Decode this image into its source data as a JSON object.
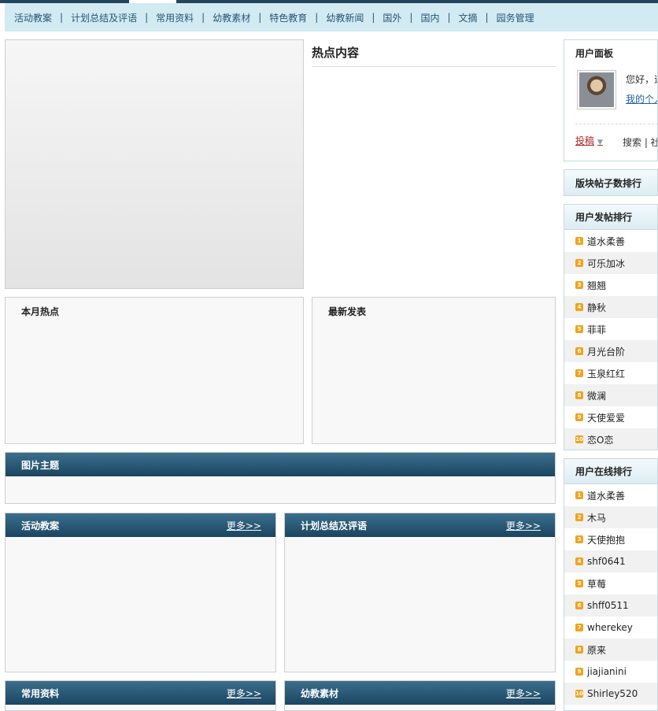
{
  "nav": {
    "items": [
      "活动教案",
      "计划总结及评语",
      "常用资料",
      "幼教素材",
      "特色教育",
      "幼教新闻",
      "国外",
      "国内",
      "文摘",
      "园务管理"
    ],
    "separator": "|"
  },
  "hot": {
    "title": "热点内容"
  },
  "month_hot": {
    "title": "本月热点"
  },
  "latest": {
    "title": "最新发表"
  },
  "photo_topic": {
    "title": "图片主题"
  },
  "sections": [
    {
      "title": "活动教案",
      "more": "更多>>"
    },
    {
      "title": "计划总结及评语",
      "more": "更多>>"
    },
    {
      "title": "常用资料",
      "more": "更多>>"
    },
    {
      "title": "幼教素材",
      "more": "更多>>"
    }
  ],
  "user_panel": {
    "title": "用户面板",
    "greeting": "您好，道",
    "my_link": "我的个人",
    "post_label": "投稿",
    "tools": "搜索 | 社"
  },
  "board_rank": {
    "title": "版块帖子数排行"
  },
  "post_rank": {
    "title": "用户发帖排行",
    "items": [
      {
        "n": "1",
        "name": "道水柔善"
      },
      {
        "n": "2",
        "name": "可乐加冰"
      },
      {
        "n": "3",
        "name": "翘翘"
      },
      {
        "n": "4",
        "name": "静秋"
      },
      {
        "n": "5",
        "name": "菲菲"
      },
      {
        "n": "6",
        "name": "月光台阶"
      },
      {
        "n": "7",
        "name": "玉泉红红"
      },
      {
        "n": "8",
        "name": "微澜"
      },
      {
        "n": "9",
        "name": "天使爱爱"
      },
      {
        "n": "10",
        "name": "恋O恋"
      }
    ]
  },
  "online_rank": {
    "title": "用户在线排行",
    "items": [
      {
        "n": "1",
        "name": "道水柔善"
      },
      {
        "n": "2",
        "name": "木马"
      },
      {
        "n": "3",
        "name": "天使抱抱"
      },
      {
        "n": "4",
        "name": "shf0641"
      },
      {
        "n": "5",
        "name": "草莓"
      },
      {
        "n": "6",
        "name": "shff0511"
      },
      {
        "n": "7",
        "name": "wherekey"
      },
      {
        "n": "8",
        "name": "原来"
      },
      {
        "n": "9",
        "name": "jiajianini"
      },
      {
        "n": "10",
        "name": "Shirley520"
      }
    ]
  },
  "colors": {
    "nav_bg": "#d2eaf1",
    "header_dark": "#1a4560",
    "badge": "#f2a31c",
    "post_red": "#b2232a",
    "link_blue": "#1f5f9a"
  },
  "icons": {
    "rank_badge": "number-badge-icon",
    "post_caret": "chevron-down-icon"
  }
}
